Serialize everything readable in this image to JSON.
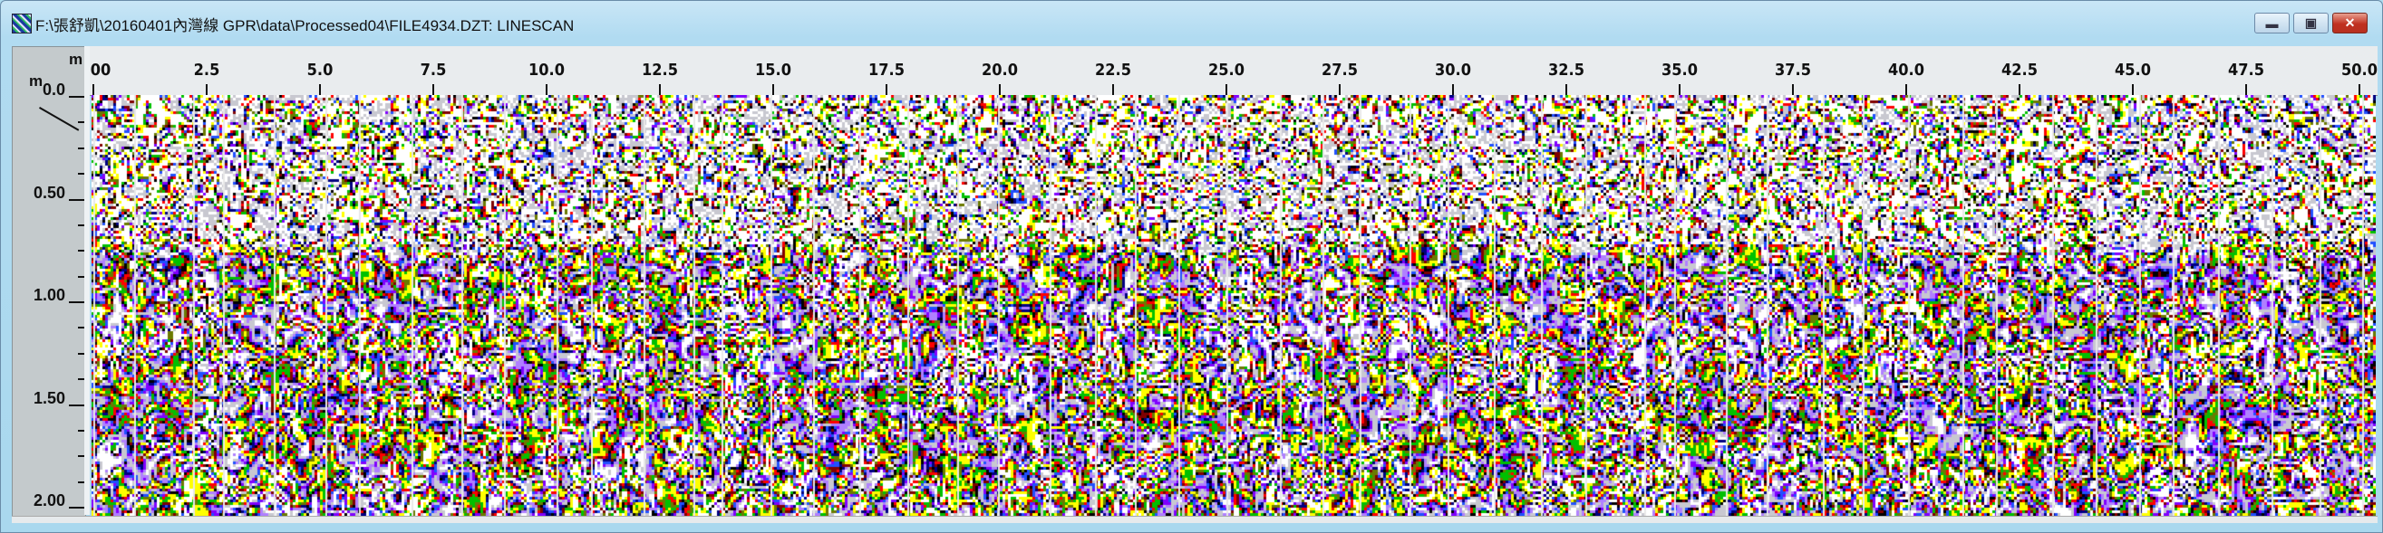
{
  "window": {
    "title": "F:\\張舒凱\\20160401內灣線 GPR\\data\\Processed04\\FILE4934.DZT:  LINESCAN",
    "controls": {
      "minimize": "▬",
      "maximize": "▣",
      "close": "✕"
    }
  },
  "axes": {
    "horizontal_unit": "m",
    "vertical_unit": "m",
    "x_labels": [
      "00",
      "2.5",
      "5.0",
      "7.5",
      "10.0",
      "12.5",
      "15.0",
      "17.5",
      "20.0",
      "22.5",
      "25.0",
      "27.5",
      "30.0",
      "32.5",
      "35.0",
      "37.5",
      "40.0",
      "42.5",
      "45.0",
      "47.5",
      "50.0"
    ],
    "x_values": [
      0,
      2.5,
      5,
      7.5,
      10,
      12.5,
      15,
      17.5,
      20,
      22.5,
      25,
      27.5,
      30,
      32.5,
      35,
      37.5,
      40,
      42.5,
      45,
      47.5,
      50
    ],
    "y_labels": [
      "0.0",
      "0.50",
      "1.00",
      "1.50",
      "2.00"
    ],
    "y_values": [
      0,
      0.5,
      1.0,
      1.5,
      2.0
    ],
    "x_range_m": [
      0,
      50
    ],
    "y_range_m": [
      0,
      2.0
    ]
  },
  "colors": {
    "palette": [
      "#ffffff",
      "#c8c8d0",
      "#b080ff",
      "#8000ff",
      "#2050ff",
      "#000080",
      "#000000",
      "#800000",
      "#ff0000",
      "#6b7a00",
      "#00c000",
      "#ffff00",
      "#ffffff"
    ]
  }
}
